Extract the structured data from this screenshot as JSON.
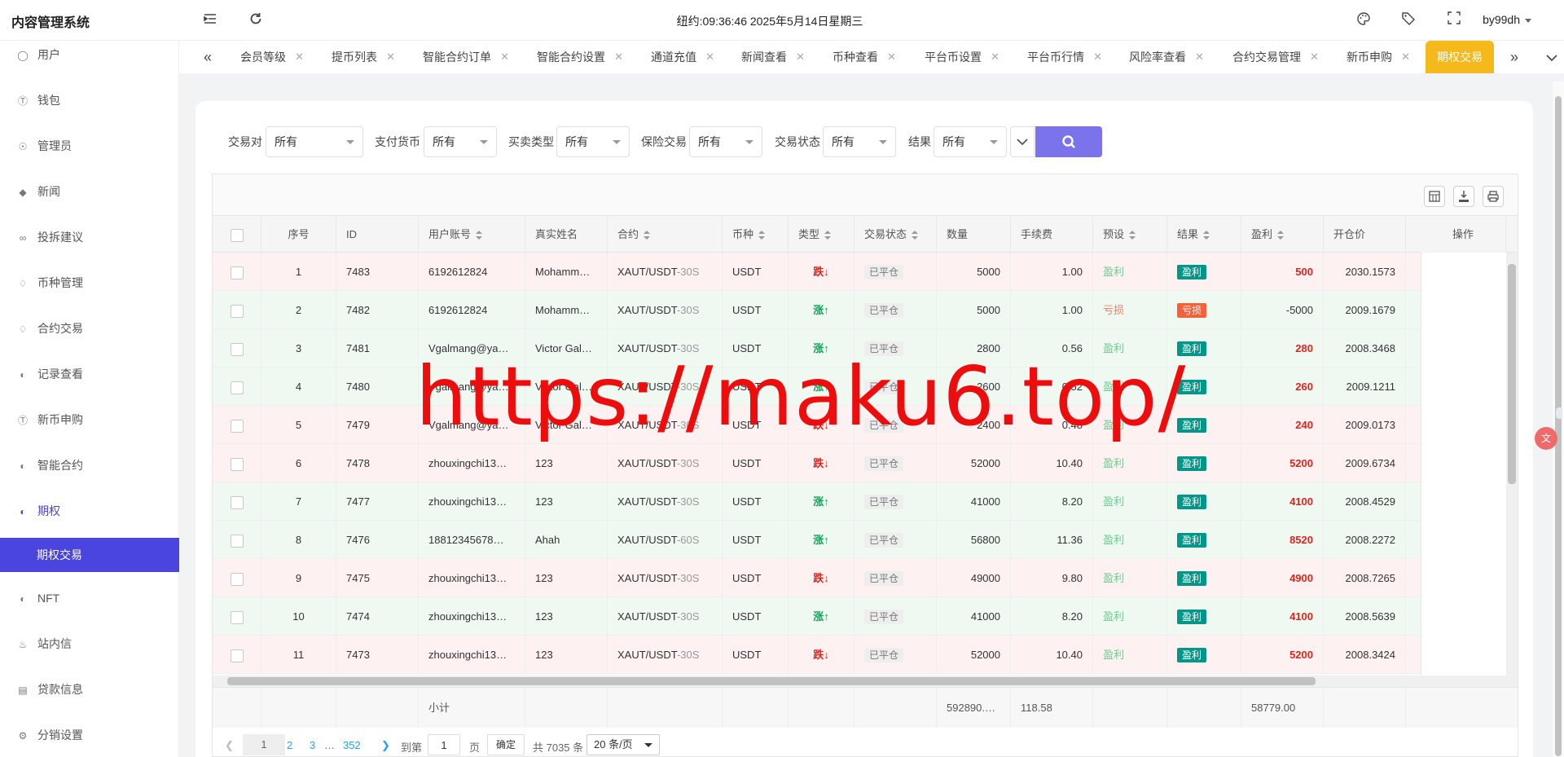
{
  "app_title": "内容管理系统",
  "header": {
    "datetime": "纽约:09:36:46 2025年5月14日星期三",
    "user": "by99dh",
    "icons": [
      "menu-fold-icon",
      "refresh-icon",
      "palette-icon",
      "tag-icon",
      "fullscreen-icon"
    ]
  },
  "sidebar": {
    "items": [
      {
        "label": "用户",
        "icon": "user-icon"
      },
      {
        "label": "钱包",
        "icon": "dollar-icon"
      },
      {
        "label": "管理员",
        "icon": "shield-icon"
      },
      {
        "label": "新闻",
        "icon": "tag-icon"
      },
      {
        "label": "投拆建议",
        "icon": "link-icon"
      },
      {
        "label": "币种管理",
        "icon": "diamond-icon"
      },
      {
        "label": "合约交易",
        "icon": "diamond-icon"
      },
      {
        "label": "记录查看",
        "icon": "history-icon"
      },
      {
        "label": "新币申购",
        "icon": "dollar-icon"
      },
      {
        "label": "智能合约",
        "icon": "history-icon"
      },
      {
        "label": "期权",
        "icon": "history-icon"
      },
      {
        "label": "NFT",
        "icon": "history-icon"
      },
      {
        "label": "站内信",
        "icon": "bell-icon"
      },
      {
        "label": "贷款信息",
        "icon": "document-icon"
      },
      {
        "label": "分销设置",
        "icon": "gear-icon"
      }
    ],
    "active_sub": "期权交易"
  },
  "tabs": {
    "items": [
      "会员等级",
      "提币列表",
      "智能合约订单",
      "智能合约设置",
      "通道充值",
      "新闻查看",
      "币种查看",
      "平台币设置",
      "平台币行情",
      "风险率查看",
      "合约交易管理",
      "新币申购"
    ],
    "active": "期权交易"
  },
  "filters": [
    {
      "label": "交易对",
      "value": "所有"
    },
    {
      "label": "支付货币",
      "value": "所有"
    },
    {
      "label": "买卖类型",
      "value": "所有"
    },
    {
      "label": "保险交易",
      "value": "所有"
    },
    {
      "label": "交易状态",
      "value": "所有"
    },
    {
      "label": "结果",
      "value": "所有"
    }
  ],
  "table": {
    "columns": [
      "序号",
      "ID",
      "用户账号",
      "真实姓名",
      "合约",
      "币种",
      "类型",
      "交易状态",
      "数量",
      "手续费",
      "预设",
      "结果",
      "盈利",
      "开仓价",
      "操作"
    ],
    "rows": [
      {
        "no": "1",
        "id": "7483",
        "account": "6192612824",
        "name": "Mohamm…",
        "pair": "XAUT/USDT",
        "period": "-30S",
        "coin": "USDT",
        "type": "跌↓",
        "dir": "down",
        "status": "已平仓",
        "qty": "5000",
        "fee": "1.00",
        "preset": "盈利",
        "preset_kind": "win",
        "result": "盈利",
        "result_kind": "win",
        "pnl": "500",
        "open": "2030.1573"
      },
      {
        "no": "2",
        "id": "7482",
        "account": "6192612824",
        "name": "Mohamm…",
        "pair": "XAUT/USDT",
        "period": "-30S",
        "coin": "USDT",
        "type": "涨↑",
        "dir": "up",
        "status": "已平仓",
        "qty": "5000",
        "fee": "1.00",
        "preset": "亏损",
        "preset_kind": "loss",
        "result": "亏损",
        "result_kind": "loss",
        "pnl": "-5000",
        "open": "2009.1679"
      },
      {
        "no": "3",
        "id": "7481",
        "account": "Vgalmang@ya…",
        "name": "Victor Gal…",
        "pair": "XAUT/USDT",
        "period": "-30S",
        "coin": "USDT",
        "type": "涨↑",
        "dir": "up",
        "status": "已平仓",
        "qty": "2800",
        "fee": "0.56",
        "preset": "盈利",
        "preset_kind": "win",
        "result": "盈利",
        "result_kind": "win",
        "pnl": "280",
        "open": "2008.3468"
      },
      {
        "no": "4",
        "id": "7480",
        "account": "Vgalmang@ya…",
        "name": "Victor Gal…",
        "pair": "XAUT/USDT",
        "period": "-30S",
        "coin": "USDT",
        "type": "涨↑",
        "dir": "up",
        "status": "已平仓",
        "qty": "2600",
        "fee": "0.52",
        "preset": "盈利",
        "preset_kind": "win",
        "result": "盈利",
        "result_kind": "win",
        "pnl": "260",
        "open": "2009.1211"
      },
      {
        "no": "5",
        "id": "7479",
        "account": "Vgalmang@ya…",
        "name": "Victor Gal…",
        "pair": "XAUT/USDT",
        "period": "-30S",
        "coin": "USDT",
        "type": "跌↓",
        "dir": "down",
        "status": "已平仓",
        "qty": "2400",
        "fee": "0.48",
        "preset": "盈利",
        "preset_kind": "win",
        "result": "盈利",
        "result_kind": "win",
        "pnl": "240",
        "open": "2009.0173"
      },
      {
        "no": "6",
        "id": "7478",
        "account": "zhouxingchi13…",
        "name": "123",
        "pair": "XAUT/USDT",
        "period": "-30S",
        "coin": "USDT",
        "type": "跌↓",
        "dir": "down",
        "status": "已平仓",
        "qty": "52000",
        "fee": "10.40",
        "preset": "盈利",
        "preset_kind": "win",
        "result": "盈利",
        "result_kind": "win",
        "pnl": "5200",
        "open": "2009.6734"
      },
      {
        "no": "7",
        "id": "7477",
        "account": "zhouxingchi13…",
        "name": "123",
        "pair": "XAUT/USDT",
        "period": "-30S",
        "coin": "USDT",
        "type": "涨↑",
        "dir": "up",
        "status": "已平仓",
        "qty": "41000",
        "fee": "8.20",
        "preset": "盈利",
        "preset_kind": "win",
        "result": "盈利",
        "result_kind": "win",
        "pnl": "4100",
        "open": "2008.4529"
      },
      {
        "no": "8",
        "id": "7476",
        "account": "18812345678…",
        "name": "Ahah",
        "pair": "XAUT/USDT",
        "period": "-60S",
        "coin": "USDT",
        "type": "涨↑",
        "dir": "up",
        "status": "已平仓",
        "qty": "56800",
        "fee": "11.36",
        "preset": "盈利",
        "preset_kind": "win",
        "result": "盈利",
        "result_kind": "win",
        "pnl": "8520",
        "open": "2008.2272"
      },
      {
        "no": "9",
        "id": "7475",
        "account": "zhouxingchi13…",
        "name": "123",
        "pair": "XAUT/USDT",
        "period": "-30S",
        "coin": "USDT",
        "type": "跌↓",
        "dir": "down",
        "status": "已平仓",
        "qty": "49000",
        "fee": "9.80",
        "preset": "盈利",
        "preset_kind": "win",
        "result": "盈利",
        "result_kind": "win",
        "pnl": "4900",
        "open": "2008.7265"
      },
      {
        "no": "10",
        "id": "7474",
        "account": "zhouxingchi13…",
        "name": "123",
        "pair": "XAUT/USDT",
        "period": "-30S",
        "coin": "USDT",
        "type": "涨↑",
        "dir": "up",
        "status": "已平仓",
        "qty": "41000",
        "fee": "8.20",
        "preset": "盈利",
        "preset_kind": "win",
        "result": "盈利",
        "result_kind": "win",
        "pnl": "4100",
        "open": "2008.5639"
      },
      {
        "no": "11",
        "id": "7473",
        "account": "zhouxingchi13…",
        "name": "123",
        "pair": "XAUT/USDT",
        "period": "-30S",
        "coin": "USDT",
        "type": "跌↓",
        "dir": "down",
        "status": "已平仓",
        "qty": "52000",
        "fee": "10.40",
        "preset": "盈利",
        "preset_kind": "win",
        "result": "盈利",
        "result_kind": "win",
        "pnl": "5200",
        "open": "2008.3424"
      }
    ],
    "totals": {
      "label": "小计",
      "qty": "592890.…",
      "fee": "118.58",
      "pnl": "58779.00"
    }
  },
  "pagination": {
    "current": "1",
    "pages": [
      "2",
      "3"
    ],
    "ellipsis": "…",
    "last": "352",
    "goto_label": "到第",
    "goto_value": "1",
    "page_unit": "页",
    "confirm": "确定",
    "total": "共 7035 条",
    "page_size": "20 条/页"
  },
  "watermark": "https://maku6.top/",
  "colors": {
    "accent": "#4b45e0",
    "active_tab": "#f5b91c",
    "search": "#7b73ec",
    "loss": "#e0241c",
    "gain": "#18a058"
  }
}
